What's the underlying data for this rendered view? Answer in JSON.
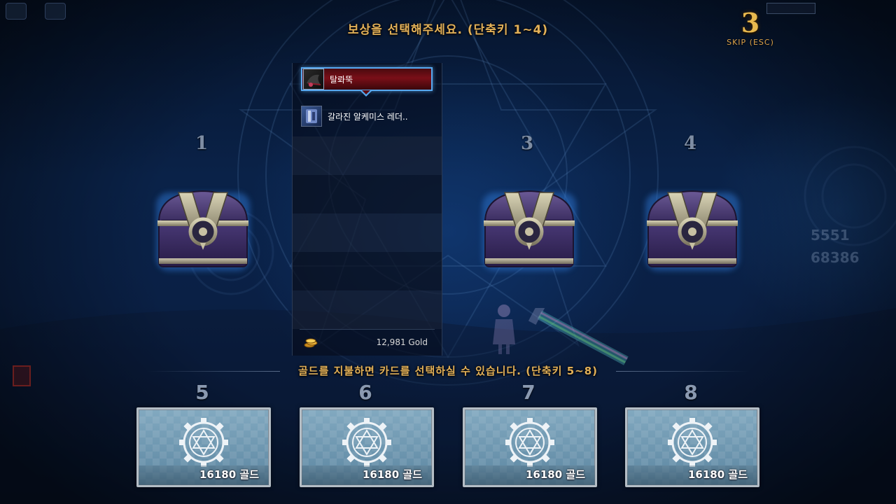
{
  "header": {
    "title": "보상을 선택해주세요. (단축키 1~4)",
    "countdown": "3",
    "skip_label": "SKIP (ESC)"
  },
  "chests": [
    {
      "number": "1",
      "icon": "treasure-chest-icon"
    },
    {
      "number": "3",
      "icon": "treasure-chest-icon"
    },
    {
      "number": "4",
      "icon": "treasure-chest-icon"
    }
  ],
  "reward_list": {
    "items": [
      {
        "name": "탈롸뚝",
        "icon": "hat-icon",
        "selected": true
      },
      {
        "name": "갈라진 알케미스 레더..",
        "icon": "leather-armor-icon",
        "selected": false
      }
    ],
    "gold": "12,981 Gold",
    "gold_icon": "gold-coin-icon"
  },
  "hint": "골드를 지불하면 카드를 선택하실 수 있습니다. (단축키 5~8)",
  "cards": [
    {
      "number": "5",
      "price": "16180 골드",
      "icon": "hexagram-gear-icon"
    },
    {
      "number": "6",
      "price": "16180 골드",
      "icon": "hexagram-gear-icon"
    },
    {
      "number": "7",
      "price": "16180 골드",
      "icon": "hexagram-gear-icon"
    },
    {
      "number": "8",
      "price": "16180 골드",
      "icon": "hexagram-gear-icon"
    }
  ],
  "colors": {
    "title_gold": "#e2b058",
    "selected_border": "#58a9f0",
    "selected_bg": "#7a0f18",
    "card_bg": "#6d94ac"
  }
}
